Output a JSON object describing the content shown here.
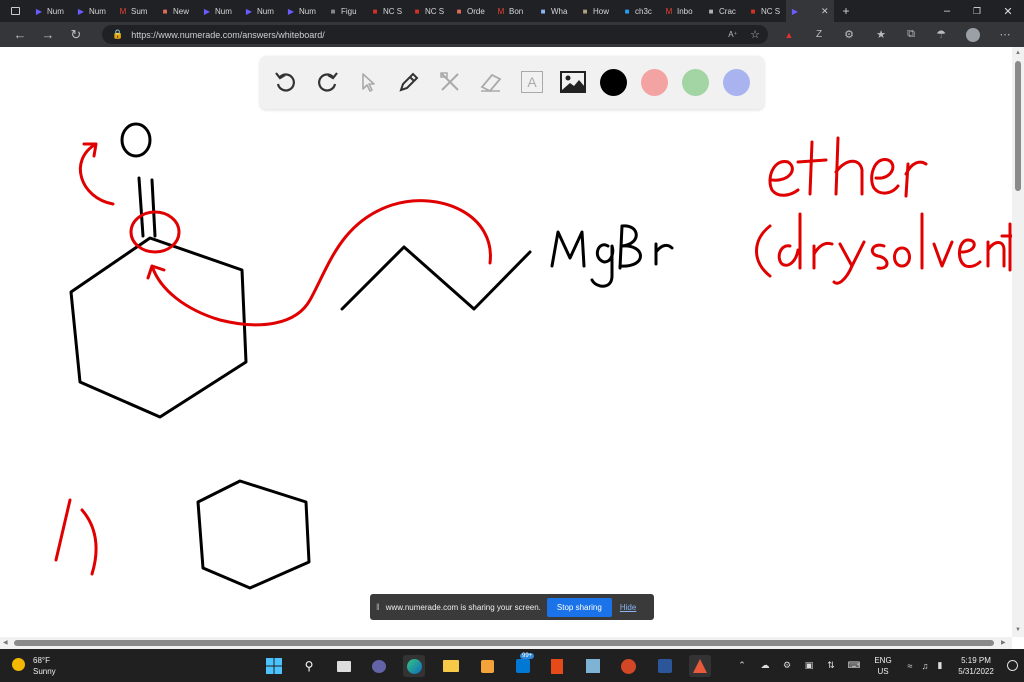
{
  "browser": {
    "tabs": [
      {
        "label": "Num",
        "icon": "numerade-icon",
        "color": "#6b5cff"
      },
      {
        "label": "Num",
        "icon": "numerade-icon",
        "color": "#6b5cff"
      },
      {
        "label": "Sum",
        "icon": "gmail-icon",
        "color": "#ea4335"
      },
      {
        "label": "New",
        "icon": "news-icon",
        "color": "#e06c5a"
      },
      {
        "label": "Num",
        "icon": "numerade-icon",
        "color": "#6b5cff"
      },
      {
        "label": "Num",
        "icon": "numerade-icon",
        "color": "#6b5cff"
      },
      {
        "label": "Num",
        "icon": "numerade-icon",
        "color": "#6b5cff"
      },
      {
        "label": "Figu",
        "icon": "figure-icon",
        "color": "#888888"
      },
      {
        "label": "NC S",
        "icon": "nc-icon",
        "color": "#d93025"
      },
      {
        "label": "NC S",
        "icon": "nc-icon",
        "color": "#d93025"
      },
      {
        "label": "Orde",
        "icon": "order-icon",
        "color": "#e06c5a"
      },
      {
        "label": "Bon",
        "icon": "gmail-icon",
        "color": "#ea4335"
      },
      {
        "label": "Wha",
        "icon": "search-icon",
        "color": "#8ab4f8"
      },
      {
        "label": "How",
        "icon": "book-icon",
        "color": "#b0a080"
      },
      {
        "label": "ch3c",
        "icon": "bing-icon",
        "color": "#2a9df4"
      },
      {
        "label": "Inbo",
        "icon": "gmail-icon",
        "color": "#ea4335"
      },
      {
        "label": "Crac",
        "icon": "check-icon",
        "color": "#b0b0b0"
      },
      {
        "label": "NC S",
        "icon": "nc-icon",
        "color": "#d93025"
      }
    ],
    "url": "https://www.numerade.com/answers/whiteboard/",
    "new_tab": "+"
  },
  "whiteboard": {
    "tools": [
      {
        "name": "undo-button",
        "icon": "undo-icon"
      },
      {
        "name": "redo-button",
        "icon": "redo-icon"
      },
      {
        "name": "select-button",
        "icon": "cursor-icon"
      },
      {
        "name": "pen-button",
        "icon": "pen-icon"
      },
      {
        "name": "tools-button",
        "icon": "tools-icon"
      },
      {
        "name": "eraser-button",
        "icon": "eraser-icon"
      },
      {
        "name": "text-button",
        "icon": "text-icon"
      },
      {
        "name": "image-button",
        "icon": "image-icon"
      }
    ],
    "text_tool_glyph": "A",
    "colors": [
      "#000000",
      "#f4a3a3",
      "#a3d4a3",
      "#a9b3f0"
    ],
    "ink_black": "#000000",
    "ink_red": "#e00000"
  },
  "share_bar": {
    "message": "www.numerade.com is sharing your screen.",
    "stop_label": "Stop sharing",
    "hide_label": "Hide"
  },
  "taskbar": {
    "weather_temp": "68°F",
    "weather_desc": "Sunny",
    "lang_top": "ENG",
    "lang_bottom": "US",
    "time": "5:19 PM",
    "date": "5/31/2022",
    "store_badge": "99+"
  }
}
